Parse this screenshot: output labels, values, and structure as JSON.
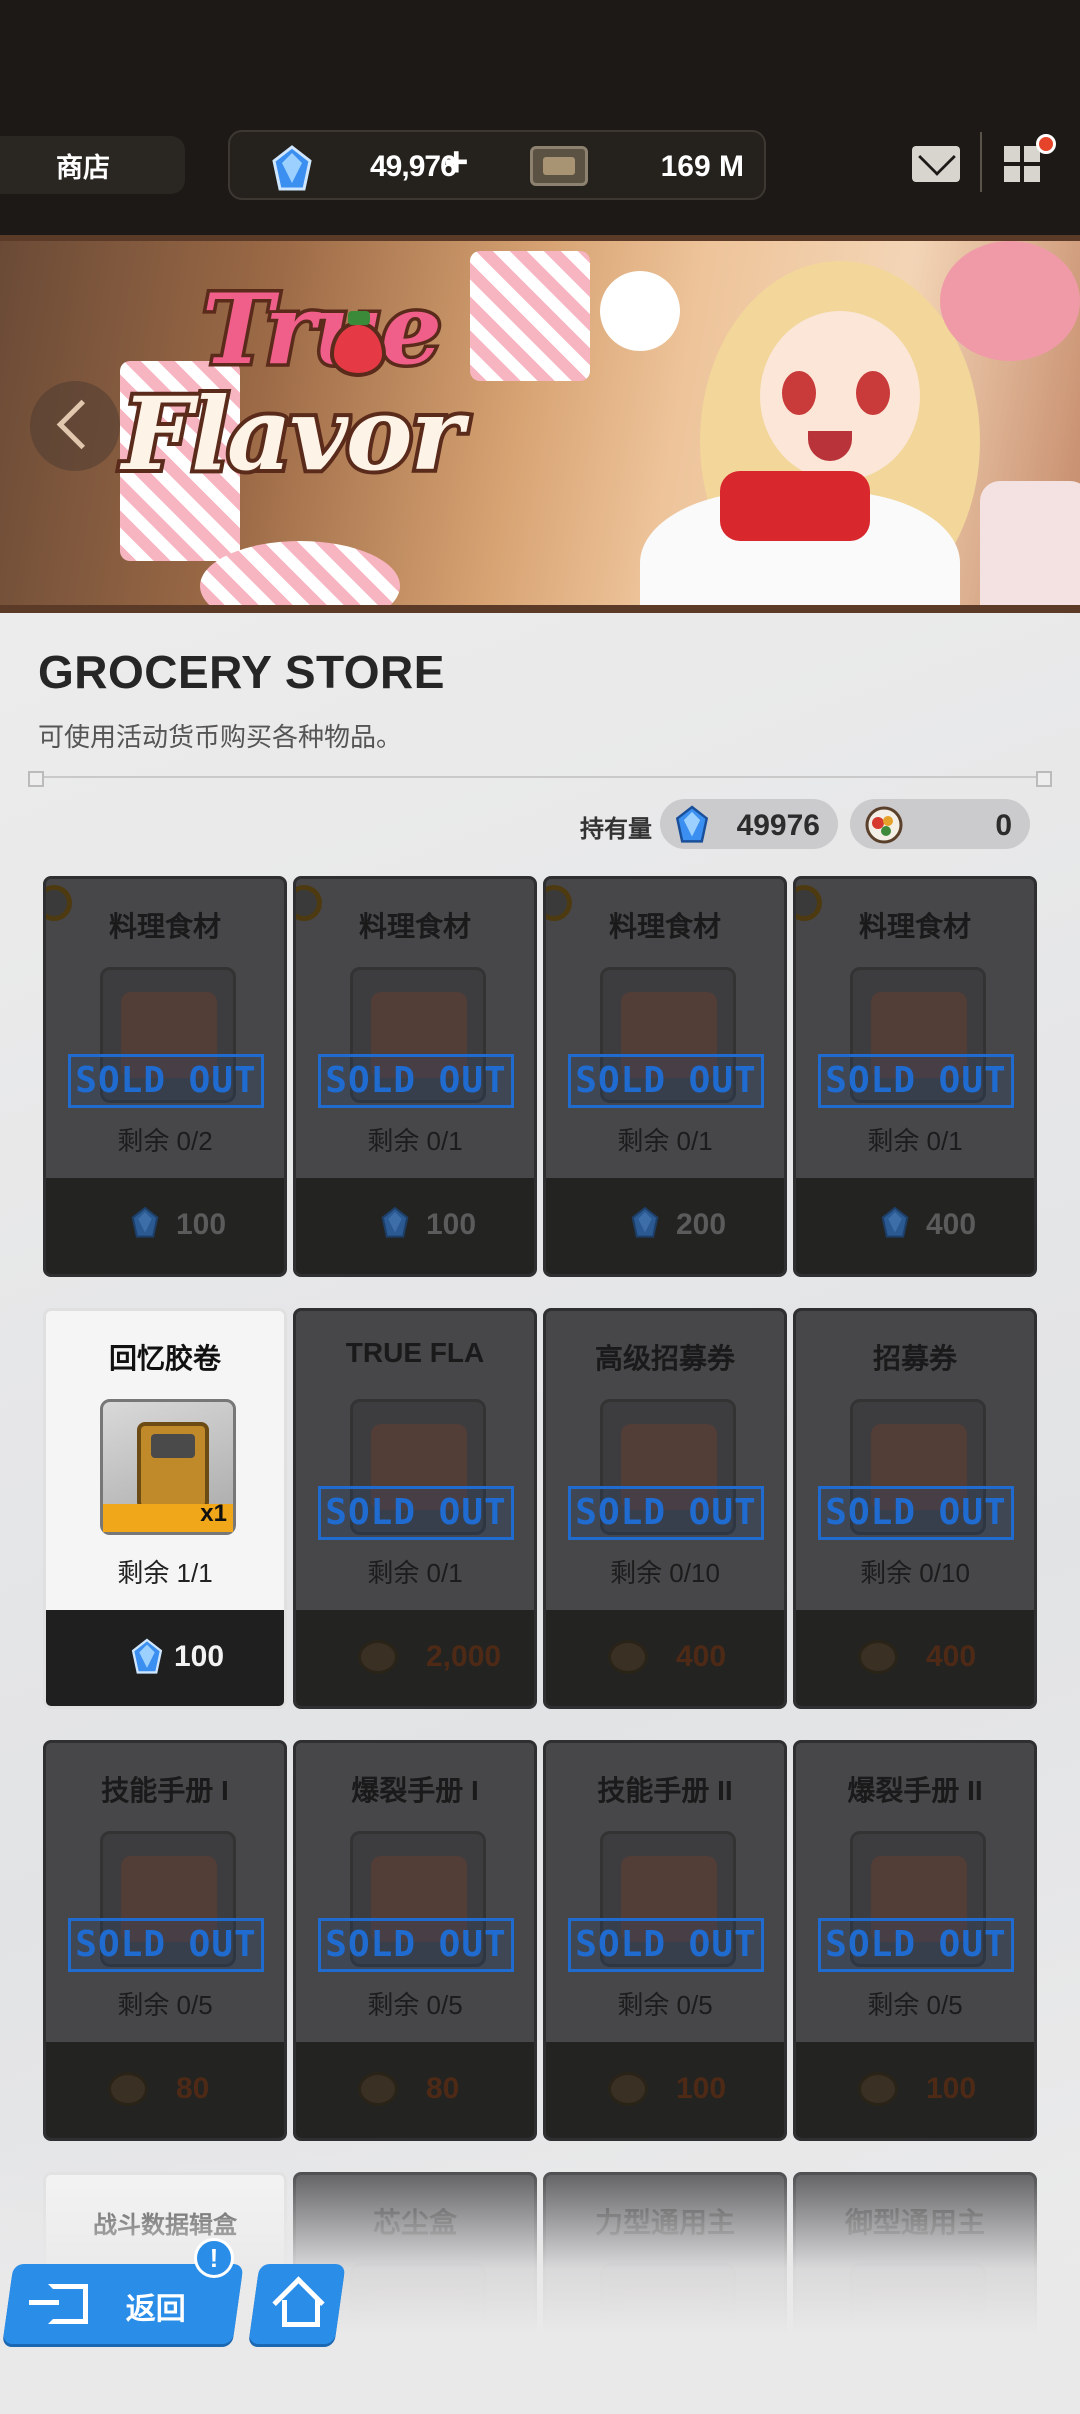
{
  "topbar": {
    "tab_label": "商店",
    "gem_amount": "49,976",
    "gem_plus": "+",
    "ticket_amount": "169 M"
  },
  "banner": {
    "logo_line1": "True",
    "logo_line2": "Flavor"
  },
  "store": {
    "title": "GROCERY STORE",
    "subtitle": "可使用活动货币购买各种物品。",
    "holdings_label": "持有量",
    "holdings_gem": "49976",
    "holdings_coin": "0",
    "sold_out_label": "SOLD OUT"
  },
  "items": [
    {
      "name": "料理食材",
      "remain": "剩余 0/2",
      "price": "100",
      "currency": "gem",
      "sold_out": true
    },
    {
      "name": "料理食材",
      "remain": "剩余 0/1",
      "price": "100",
      "currency": "gem",
      "sold_out": true
    },
    {
      "name": "料理食材",
      "remain": "剩余 0/1",
      "price": "200",
      "currency": "gem",
      "sold_out": true
    },
    {
      "name": "料理食材",
      "remain": "剩余 0/1",
      "price": "400",
      "currency": "gem",
      "sold_out": true
    },
    {
      "name": "回忆胶卷",
      "remain": "剩余 1/1",
      "price": "100",
      "currency": "gem",
      "sold_out": false,
      "quantity": "x1"
    },
    {
      "name": "TRUE FLA",
      "remain": "剩余 0/1",
      "price": "2,000",
      "currency": "coin",
      "sold_out": true
    },
    {
      "name": "高级招募券",
      "remain": "剩余 0/10",
      "price": "400",
      "currency": "coin",
      "sold_out": true
    },
    {
      "name": "招募券",
      "remain": "剩余 0/10",
      "price": "400",
      "currency": "coin",
      "sold_out": true
    },
    {
      "name": "技能手册 I",
      "remain": "剩余 0/5",
      "price": "80",
      "currency": "coin",
      "sold_out": true
    },
    {
      "name": "爆裂手册 I",
      "remain": "剩余 0/5",
      "price": "80",
      "currency": "coin",
      "sold_out": true
    },
    {
      "name": "技能手册 II",
      "remain": "剩余 0/5",
      "price": "100",
      "currency": "coin",
      "sold_out": true
    },
    {
      "name": "爆裂手册 II",
      "remain": "剩余 0/5",
      "price": "100",
      "currency": "coin",
      "sold_out": true
    },
    {
      "name": "战斗数据辑盒",
      "remain": "",
      "price": "",
      "currency": "",
      "sold_out": false
    },
    {
      "name": "芯尘盒",
      "remain": "",
      "price": "",
      "currency": "",
      "sold_out": false
    },
    {
      "name": "力型通用主",
      "remain": "",
      "price": "",
      "currency": "",
      "sold_out": false
    },
    {
      "name": "御型通用主",
      "remain": "",
      "price": "",
      "currency": "",
      "sold_out": false
    }
  ],
  "nav": {
    "back_label": "返回",
    "info_badge": "!"
  },
  "colors": {
    "accent_blue": "#2a8de8",
    "sold_out_blue": "#1f6bd0",
    "notification_red": "#e5432a"
  },
  "icons": {
    "gem": "blue-crystal-icon",
    "coin": "food-plate-coin-icon",
    "ticket": "ticket-icon",
    "mail": "mail-icon",
    "menu": "grid-menu-icon",
    "back": "exit-door-icon",
    "home": "home-icon"
  }
}
